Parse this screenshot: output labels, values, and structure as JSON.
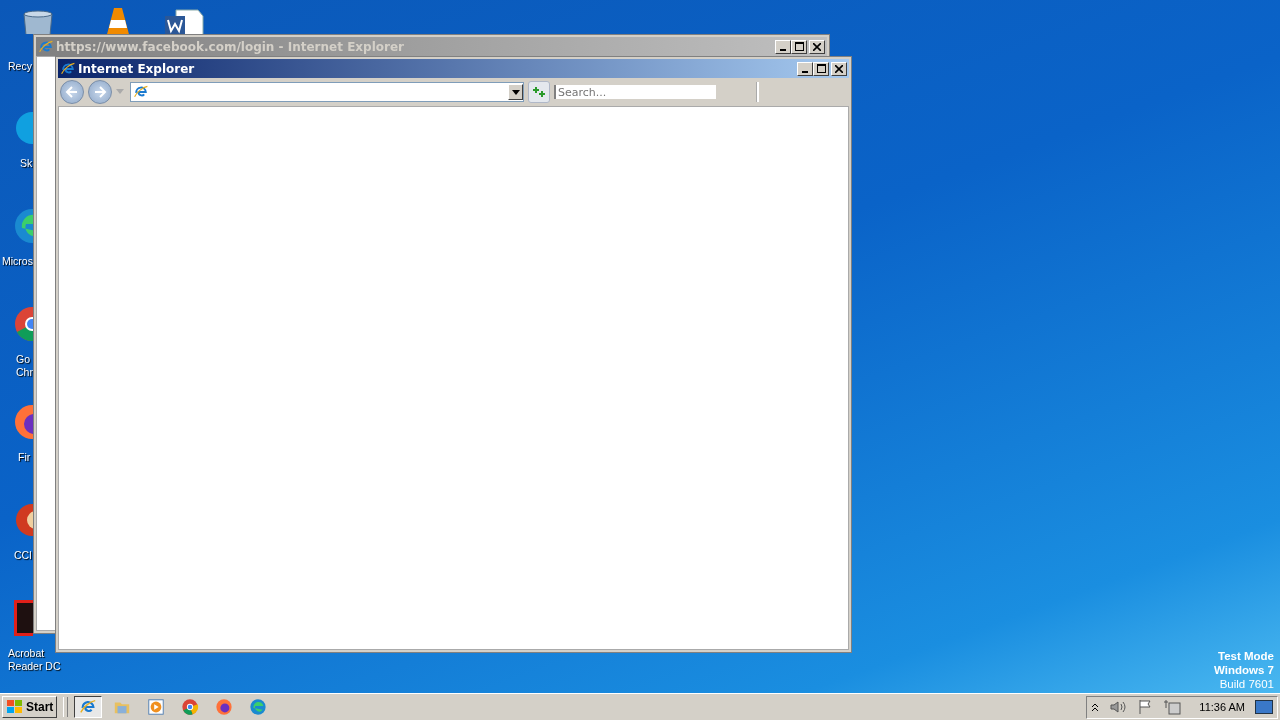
{
  "desktop_icons": [
    {
      "kind": "recycle-bin",
      "lines": [
        "Recy"
      ]
    },
    {
      "kind": "cone"
    },
    {
      "kind": "document"
    },
    {
      "kind": "skype",
      "lines": [
        "Sk"
      ]
    },
    {
      "kind": "edge",
      "lines": [
        "Micros"
      ]
    },
    {
      "kind": "chrome",
      "lines": [
        "Go",
        "Chr"
      ]
    },
    {
      "kind": "firefox",
      "lines": [
        "Fir"
      ]
    },
    {
      "kind": "ccleaner",
      "lines": [
        "CCl"
      ]
    },
    {
      "kind": "acrobat",
      "lines": [
        "Acrobat",
        "Reader DC"
      ]
    }
  ],
  "windows": [
    {
      "title": "https://www.facebook.com/login - Internet Explorer",
      "active": false
    },
    {
      "title": "Internet Explorer",
      "active": true,
      "toolbar": {
        "search": {
          "placeholder": "Search..."
        }
      }
    }
  ],
  "os_notice": [
    {
      "text": "Test Mode",
      "bold": true
    },
    {
      "text": "Windows 7",
      "bold": true
    },
    {
      "text": "Build 7601",
      "bold": false
    }
  ],
  "taskbar": {
    "start": "Start",
    "items": [
      {
        "kind": "ie",
        "selected": true
      },
      {
        "kind": "folder",
        "selected": false
      },
      {
        "kind": "media",
        "selected": false
      },
      {
        "kind": "chrome",
        "selected": false
      },
      {
        "kind": "firefox",
        "selected": false
      },
      {
        "kind": "edge",
        "selected": false
      }
    ],
    "clock": "11:36 AM"
  }
}
